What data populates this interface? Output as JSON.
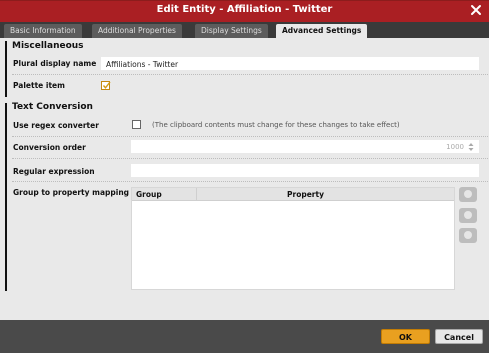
{
  "window": {
    "title": "Edit Entity - Affiliation - Twitter"
  },
  "tabs": [
    {
      "label": "Basic Information",
      "active": false
    },
    {
      "label": "Additional Properties",
      "active": false
    },
    {
      "label": "Display Settings",
      "active": false
    },
    {
      "label": "Advanced Settings",
      "active": true
    }
  ],
  "misc": {
    "heading": "Miscellaneous",
    "plural_label": "Plural display name",
    "plural_value": "Affiliations - Twitter",
    "palette_label": "Palette item",
    "palette_checked": true
  },
  "text_conversion": {
    "heading": "Text Conversion",
    "regex_label": "Use regex converter",
    "regex_checked": false,
    "regex_hint": "(The clipboard contents must change for these changes to take effect)",
    "order_label": "Conversion order",
    "order_value": "1000",
    "regexp_label": "Regular expression",
    "regexp_value": "",
    "mapping_label": "Group to property mapping",
    "mapping_columns": [
      "Group",
      "Property"
    ]
  },
  "footer": {
    "ok_label": "OK",
    "cancel_label": "Cancel"
  },
  "colors": {
    "titlebar": "#aa1f23",
    "ok_button": "#e9a020"
  }
}
